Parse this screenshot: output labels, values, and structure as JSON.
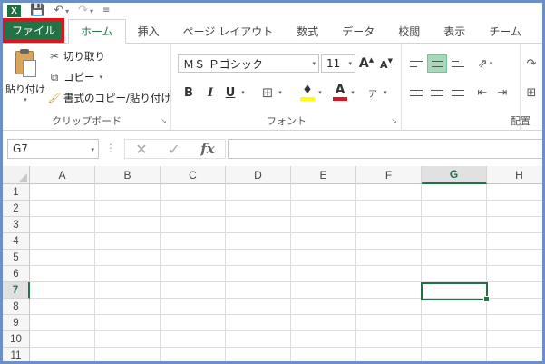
{
  "quick_access": {
    "app_icon": "excel-icon",
    "icons": [
      "save-icon",
      "undo-icon",
      "redo-icon",
      "customize-icon"
    ]
  },
  "tabs": [
    {
      "label": "ファイル",
      "kind": "file"
    },
    {
      "label": "ホーム",
      "kind": "active"
    },
    {
      "label": "挿入"
    },
    {
      "label": "ページ レイアウト"
    },
    {
      "label": "数式"
    },
    {
      "label": "データ"
    },
    {
      "label": "校閲"
    },
    {
      "label": "表示"
    },
    {
      "label": "チーム"
    }
  ],
  "ribbon": {
    "clipboard": {
      "paste_label": "貼り付け",
      "cut_label": "切り取り",
      "copy_label": "コピー",
      "format_painter_label": "書式のコピー/貼り付け",
      "group_label": "クリップボード"
    },
    "font": {
      "font_name": "ＭＳ Ｐゴシック",
      "font_size": "11",
      "bold": "B",
      "italic": "I",
      "underline": "U",
      "font_color_letter": "A",
      "grow_font": "A",
      "shrink_font": "A",
      "group_label": "フォント"
    },
    "alignment": {
      "group_label": "配置"
    }
  },
  "formula_bar": {
    "name_box": "G7",
    "cancel_symbol": "✕",
    "enter_symbol": "✓",
    "fx_label": "fx",
    "formula_value": ""
  },
  "sheet": {
    "columns": [
      "A",
      "B",
      "C",
      "D",
      "E",
      "F",
      "G",
      "H"
    ],
    "rows": [
      "1",
      "2",
      "3",
      "4",
      "5",
      "6",
      "7",
      "8",
      "9",
      "10",
      "11"
    ],
    "active_column": "G",
    "active_row": "7"
  },
  "colors": {
    "excel_green": "#217346",
    "highlight_red": "#e0141e",
    "frame_blue": "#6b8fc7"
  }
}
